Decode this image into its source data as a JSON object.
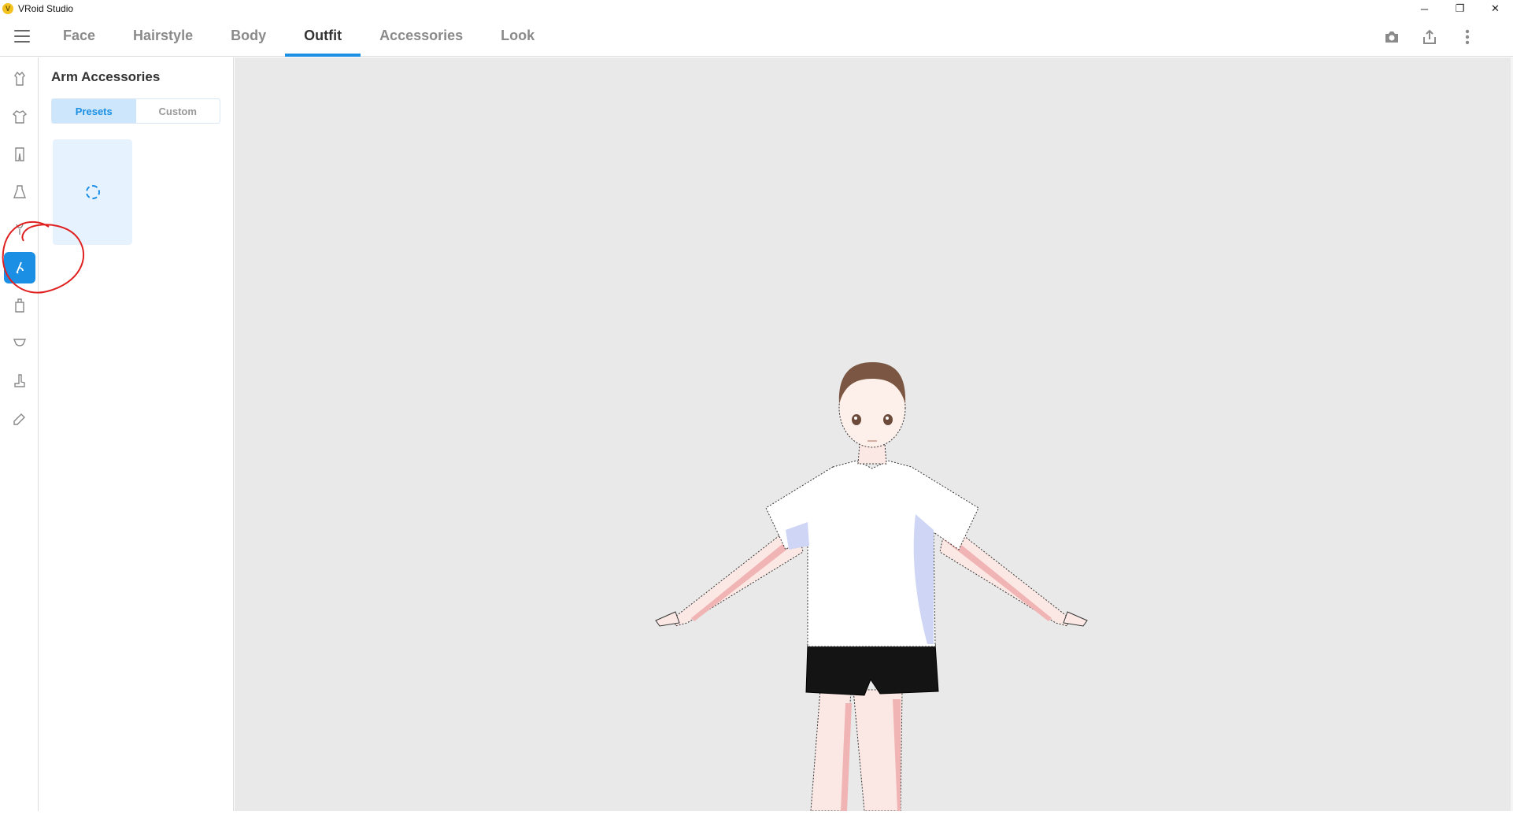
{
  "app": {
    "title": "VRoid Studio",
    "logo_glyph": "V"
  },
  "window_controls": {
    "minimize": "─",
    "restore": "❐",
    "close": "✕"
  },
  "tabs": [
    {
      "label": "Face"
    },
    {
      "label": "Hairstyle"
    },
    {
      "label": "Body"
    },
    {
      "label": "Outfit",
      "active": true
    },
    {
      "label": "Accessories"
    },
    {
      "label": "Look"
    }
  ],
  "top_actions": [
    "camera-icon",
    "export-icon",
    "more-vertical-icon"
  ],
  "leftbar": {
    "items": [
      {
        "icon": "full-outfit-icon"
      },
      {
        "icon": "tops-icon"
      },
      {
        "icon": "bottoms-icon"
      },
      {
        "icon": "onepiece-icon"
      },
      {
        "icon": "neck-accessory-icon"
      },
      {
        "icon": "arm-accessory-icon",
        "active": true
      },
      {
        "icon": "gloves-icon"
      },
      {
        "icon": "socks-icon"
      },
      {
        "icon": "shoes-icon"
      },
      {
        "icon": "accessory-tag-icon"
      }
    ]
  },
  "panel": {
    "title": "Arm Accessories",
    "segment": {
      "presets": "Presets",
      "custom": "Custom",
      "active": "presets"
    }
  },
  "colors": {
    "accent": "#1b8fe3",
    "viewport_bg": "#e9e9e9",
    "annotation": "#e02020"
  }
}
